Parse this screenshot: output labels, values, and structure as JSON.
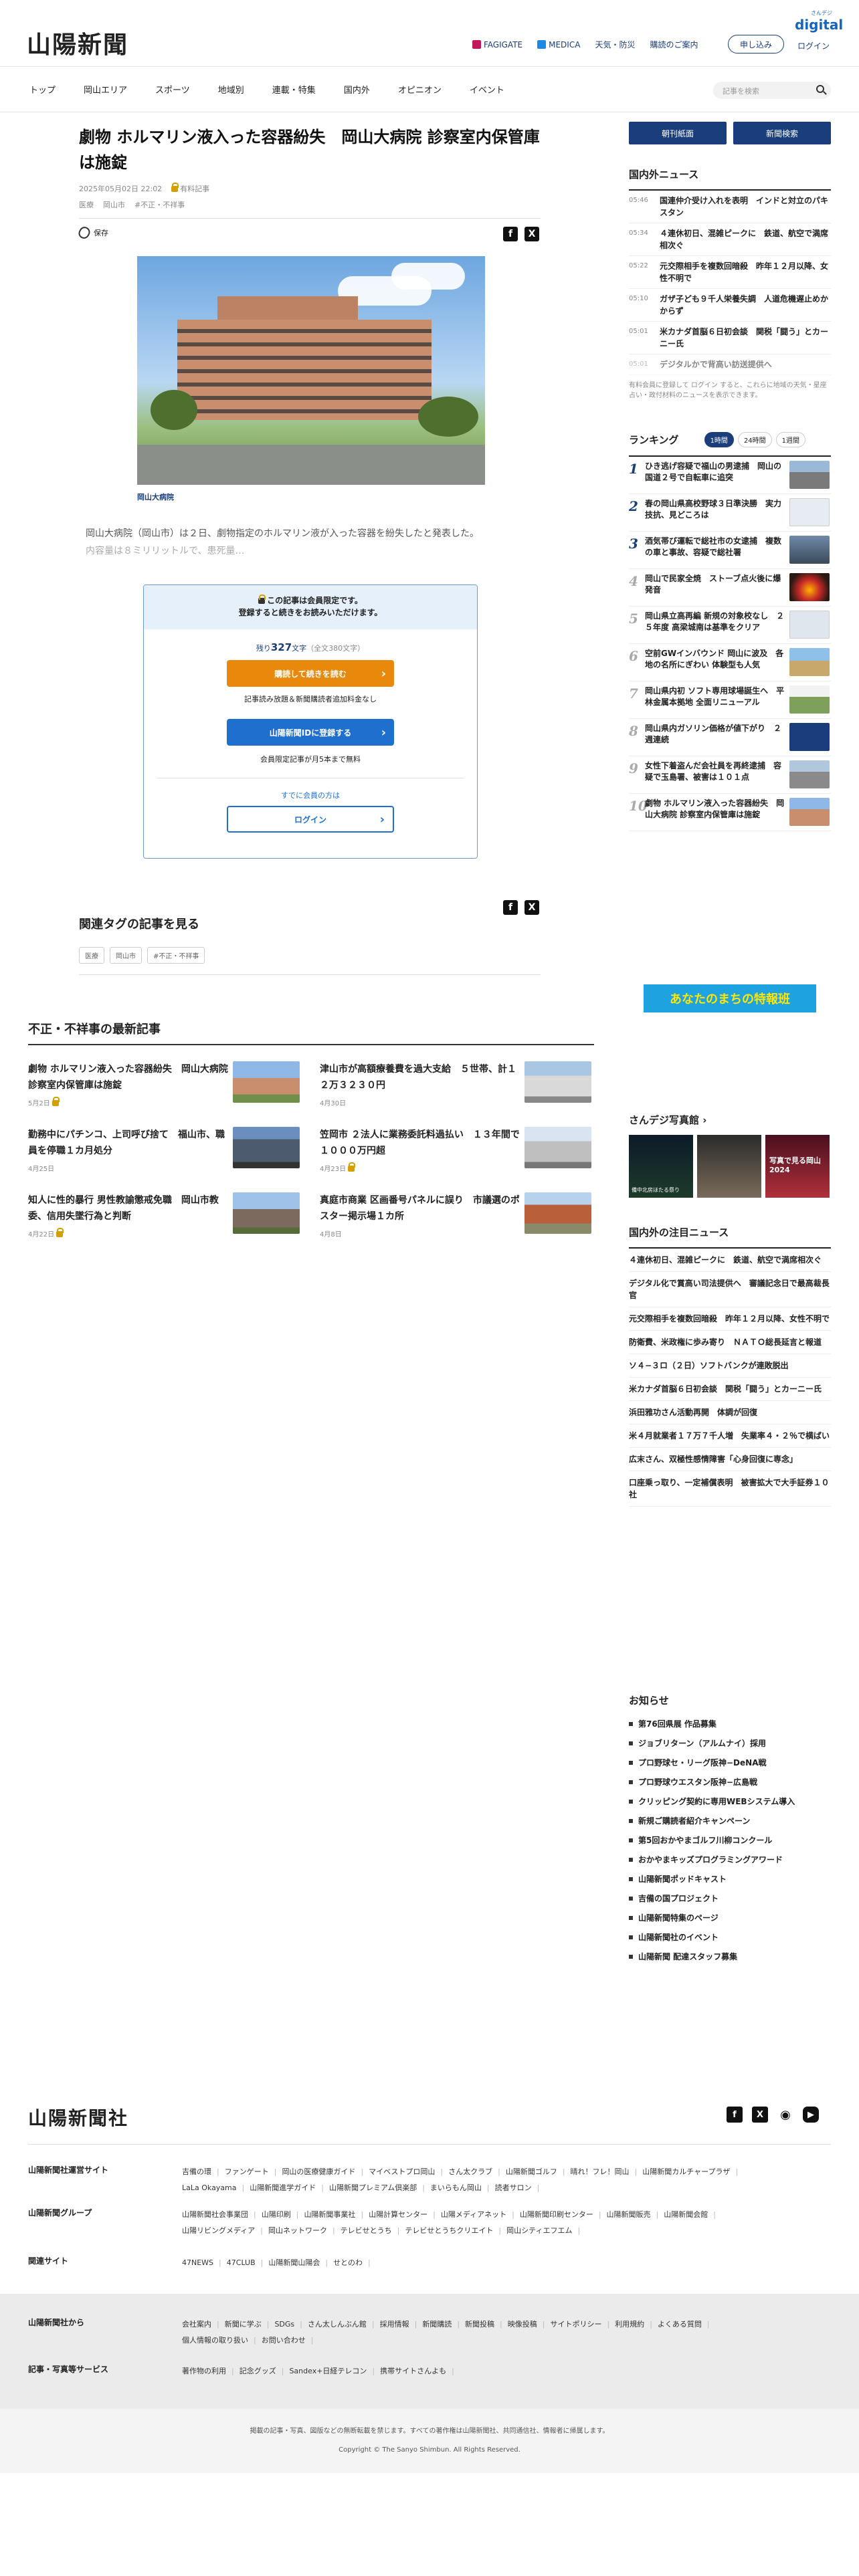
{
  "header": {
    "logo": "山陽新聞",
    "digital_small": "さんデジ",
    "digital": "digital",
    "toplinks": [
      "FAGIGATE",
      "MEDICA",
      "天気・防災",
      "購読のご案内"
    ],
    "signup": "申し込み",
    "login": "ログイン"
  },
  "nav": {
    "items": [
      "トップ",
      "岡山エリア",
      "スポーツ",
      "地域別",
      "連載・特集",
      "国内外",
      "オピニオン",
      "イベント"
    ],
    "search_placeholder": "記事を検索"
  },
  "article": {
    "title": "劇物 ホルマリン液入った容器紛失　岡山大病院 診察室内保管庫は施錠",
    "date": "2025年05月02日 22:02",
    "badge": "有料記事",
    "tags": [
      "医療",
      "岡山市",
      "#不正・不祥事"
    ],
    "save": "保存",
    "photo_caption": "岡山大病院",
    "lead": "岡山大病院（岡山市）は２日、劇物指定のホルマリン液が入った容器を紛失したと発表した。",
    "lead_fade": "内容量は８ミリリットルで、患死量…"
  },
  "paywall": {
    "head1": "この記事は会員限定です。",
    "head2": "登録すると続きをお読みいただけます。",
    "remaining_pre": "残り",
    "remaining_num": "327",
    "remaining_post": "文字",
    "remaining_total": "（全文380文字）",
    "btn1": "購読して続きを読む",
    "note1": "記事読み放題＆新聞購読者追加料金なし",
    "btn2": "山陽新聞IDに登録する",
    "note2": "会員限定記事が月5本まで無料",
    "already": "すでに会員の方は",
    "login": "ログイン"
  },
  "related": {
    "heading": "関連タグの記事を見る",
    "tags": [
      "医療",
      "岡山市",
      "#不正・不祥事"
    ]
  },
  "latest": {
    "heading": "不正・不祥事の最新記事",
    "items": [
      {
        "title": "劇物 ホルマリン液入った容器紛失　岡山大病院 診察室内保管庫は施錠",
        "date": "5月2日"
      },
      {
        "title": "津山市が高額療養費を過大支給　５世帯、計１２万３２３０円",
        "date": "4月30日"
      },
      {
        "title": "勤務中にパチンコ、上司呼び捨て　福山市、職員を停職１カ月処分",
        "date": "4月25日"
      },
      {
        "title": "笠岡市 ２法人に業務委託料過払い　１３年間で１０００万円超",
        "date": "4月23日"
      },
      {
        "title": "知人に性的暴行 男性教諭懲戒免職　岡山市教委、信用失墜行為と判断",
        "date": "4月22日"
      },
      {
        "title": "真庭市商業 区画番号パネルに誤り　市議選のポスター掲示場１カ所",
        "date": "4月8日"
      }
    ]
  },
  "right": {
    "btn_paper": "朝刊紙面",
    "btn_search": "新聞検索",
    "domestic_heading": "国内外ニュース",
    "domestic": [
      {
        "time": "05:46",
        "text": "国連仲介受け入れを表明　インドと対立のパキスタン"
      },
      {
        "time": "05:34",
        "text": "４連休初日、混雑ピークに　鉄道、航空で満席相次ぐ"
      },
      {
        "time": "05:22",
        "text": "元交際相手を複数回暗殺　昨年１２月以降、女性不明で"
      },
      {
        "time": "05:10",
        "text": "ガザ子ども９千人栄養失調　人道危機遅止めかからず"
      },
      {
        "time": "05:01",
        "text": "米カナダ首脳６日初会談　関税「闘う」とカーニー氏"
      },
      {
        "time": "05:01",
        "text": "デジタルかで背高い訪送提供へ"
      }
    ],
    "domestic_note": "有料会員に登録して ログイン すると、これらに地域の天気・星座占い・政付材料のニュースを表示できます。",
    "ranking_heading": "ランキング",
    "ranking_tabs": [
      "1時間",
      "24時間",
      "1週間"
    ],
    "ranking": [
      "ひき逃げ容疑で福山の男逮捕　岡山の国道２号で自転車に追突",
      "春の岡山県高校野球３日準決勝　実力技抗、見どころは",
      "酒気帯び運転で総社市の女逮捕　複数の車と事故、容疑で総社署",
      "岡山で民家全焼　ストーブ点火後に爆発音",
      "岡山県立高再編 新規の対象校なし　２５年度 高梁城南は基準をクリア",
      "空前GWインバウンド 岡山に波及　各地の名所にぎわい 体験型も人気",
      "岡山県内初 ソフト専用球場誕生へ　平林金属本拠地 全面リニューアル",
      "岡山県内ガソリン価格が値下がり　２週連続",
      "女性下着盗んだ会社員を再終逮捕　容疑で玉島署、被害は１０１点",
      "劇物 ホルマリン液入った容器紛失　岡山大病院 診察室内保管庫は施錠"
    ],
    "banner": "あなたのまちの特報班",
    "photo_heading": "さんデジ写真館",
    "photo_captions": [
      "備中北房ほたる祭り",
      "",
      "写真で見る岡山2024"
    ],
    "domestic_focus_heading": "国内外の注目ニュース",
    "focus": [
      "４連休初日、混雑ピークに　鉄道、航空で満席相次ぐ",
      "デジタル化で賞高い司法提供へ　審議記念日で最高裁長官",
      "元交際相手を複数回暗殺　昨年１２月以降、女性不明で",
      "防衛費、米政権に歩み寄り　ＮＡＴＯ総長延言と報道",
      "ソ４−３ロ（２日）ソフトバンクが連敗脱出",
      "米カナダ首脳６日初会談　関税「闘う」とカーニー氏",
      "浜田雅功さん活動再開　体調が回復",
      "米４月就業者１７万７千人増　失業率４・２％で横ばい",
      "広末さん、双極性感情障害「心身回復に専念」",
      "口座乗っ取り、一定補償表明　被害拡大で大手証券１０社"
    ],
    "notice_heading": "お知らせ",
    "notices": [
      "第76回県展 作品募集",
      "ジョブリターン（アルムナイ）採用",
      "プロ野球セ・リーグ阪神−DeNA戦",
      "プロ野球ウエスタン阪神−広島戦",
      "クリッピング契約に専用WEBシステム導入",
      "新規ご購読者紹介キャンペーン",
      "第5回おかやまゴルフ川柳コンクール",
      "おかやまキッズプログラミングアワード",
      "山陽新聞ポッドキャスト",
      "吉備の国プロジェクト",
      "山陽新聞特集のページ",
      "山陽新聞社のイベント",
      "山陽新聞 配達スタッフ募集"
    ]
  },
  "footer": {
    "logo": "山陽新聞社",
    "rows": [
      {
        "label": "山陽新聞社運営サイト",
        "links": [
          "吉備の環",
          "ファンゲート",
          "岡山の医療健康ガイド",
          "マイベストプロ岡山",
          "さん太クラブ",
          "山陽新聞ゴルフ",
          "晴れ！フレ！岡山",
          "山陽新聞カルチャープラザ",
          "LaLa Okayama",
          "山陽新聞進学ガイド",
          "山陽新聞プレミアム倶楽部",
          "まいらもん岡山",
          "読者サロン"
        ]
      },
      {
        "label": "山陽新聞グループ",
        "links": [
          "山陽新聞社会事業団",
          "山陽印刷",
          "山陽新聞事業社",
          "山陽計算センター",
          "山陽メディアネット",
          "山陽新聞印刷センター",
          "山陽新聞販売",
          "山陽新聞会館",
          "山陽リビングメディア",
          "岡山ネットワーク",
          "テレビせとうち",
          "テレビせとうちクリエイト",
          "岡山シティエフエム"
        ]
      },
      {
        "label": "関連サイト",
        "links": [
          "47NEWS",
          "47CLUB",
          "山陽新聞山陽会",
          "せとのわ"
        ]
      },
      {
        "label": "山陽新聞社から",
        "links": [
          "会社案内",
          "新聞に学ぶ",
          "SDGs",
          "さん太しんぶん館",
          "採用情報",
          "新聞購読",
          "新聞投稿",
          "映像投稿",
          "サイトポリシー",
          "利用規約",
          "よくある質問",
          "個人情報の取り扱い",
          "お問い合わせ"
        ]
      },
      {
        "label": "記事・写真等サービス",
        "links": [
          "著作物の利用",
          "記念グッズ",
          "Sandex+日経テレコン",
          "携帯サイトさんよも"
        ]
      }
    ],
    "note": "掲載の記事・写真、図版などの無断転載を禁じます。すべての著作権は山陽新聞社、共同通信社、情報者に帰属します。",
    "copyright": "Copyright © The Sanyo Shimbun. All Rights Reserved."
  }
}
